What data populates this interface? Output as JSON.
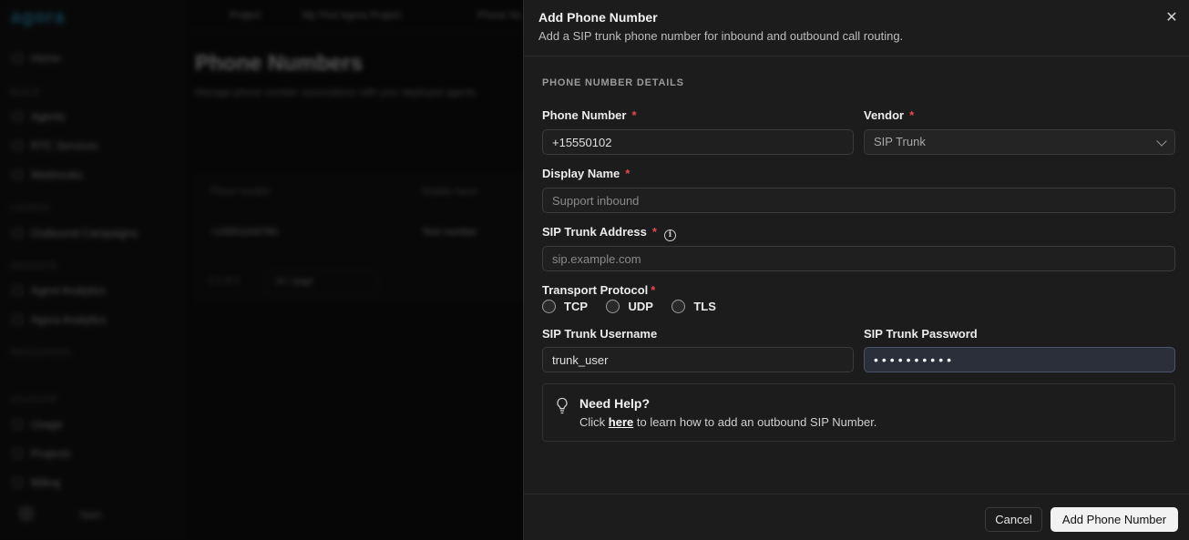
{
  "background": {
    "logo": "agora",
    "nav": {
      "home": "Home",
      "build_section": "BUILD",
      "agents": "Agents",
      "rtc_services": "RTC Services",
      "webhooks": "Webhooks",
      "launch_section": "LAUNCH",
      "outbound_campaigns": "Outbound Campaigns",
      "insights_section": "INSIGHTS",
      "agent_analytics_1": "Agent Analytics",
      "agent_analytics_2": "Agora Analytics",
      "resources_section": "RESOURCES",
      "account_section": "ACCOUNT",
      "usage": "Usage",
      "projects": "Projects",
      "billing": "Billing",
      "user": "Nam"
    },
    "topbar": {
      "project_label": "Project",
      "project_name": "My First Agora Project",
      "page_crumb": "Phone Nu"
    },
    "page_title": "Phone Numbers",
    "page_subtitle": "Manage phone number associations with your deployed agents",
    "table": {
      "col_phone": "Phone number",
      "col_display": "Display name",
      "row_phone": "+15551043780",
      "row_display": "Test number",
      "pagination": "1-1 of 1",
      "per_page": "10 / page"
    }
  },
  "drawer": {
    "title": "Add Phone Number",
    "subtitle": "Add a SIP trunk phone number for inbound and outbound call routing.",
    "close_symbol": "✕",
    "section_title": "PHONE NUMBER DETAILS",
    "fields": {
      "phone_number": {
        "label": "Phone Number",
        "required": "*",
        "value": "+15550102"
      },
      "vendor": {
        "label": "Vendor",
        "required": "*",
        "value": "SIP Trunk"
      },
      "display_name": {
        "label": "Display Name",
        "required": "*",
        "placeholder": "Support inbound"
      },
      "sip_address": {
        "label": "SIP Trunk Address",
        "required": "*",
        "placeholder": "sip.example.com",
        "info_glyph": "i"
      },
      "transport": {
        "label": "Transport Protocol",
        "required": "*",
        "options": [
          "TCP",
          "UDP",
          "TLS"
        ]
      },
      "sip_username": {
        "label": "SIP Trunk Username",
        "value": "trunk_user"
      },
      "sip_password": {
        "label": "SIP Trunk Password",
        "value": "••••••••••"
      }
    },
    "help": {
      "title": "Need Help?",
      "text_before": "Click ",
      "link": "here",
      "text_after": " to learn how to add an outbound SIP Number."
    },
    "buttons": {
      "cancel": "Cancel",
      "submit": "Add Phone Number"
    }
  },
  "colors": {
    "panel_bg": "#1c1c1c",
    "required": "#e5484d",
    "accent_logo": "#2aa3d8",
    "primary_button": "#f2f2f2"
  }
}
